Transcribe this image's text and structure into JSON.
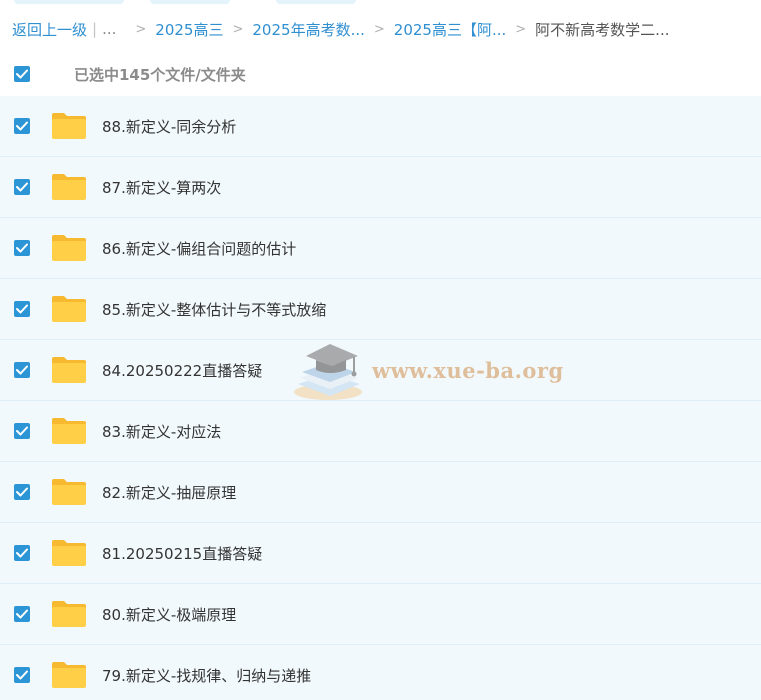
{
  "breadcrumb": {
    "back_label": "返回上一级",
    "ellipsis": "...",
    "items": [
      "2025高三",
      "2025年高考数...",
      "2025高三【阿...",
      "阿不新高考数学二..."
    ]
  },
  "selection": {
    "summary": "已选中145个文件/文件夹",
    "all_checked": true
  },
  "files": [
    {
      "name": "88.新定义-同余分析",
      "type": "folder",
      "checked": true
    },
    {
      "name": "87.新定义-算两次",
      "type": "folder",
      "checked": true
    },
    {
      "name": "86.新定义-偏组合问题的估计",
      "type": "folder",
      "checked": true
    },
    {
      "name": "85.新定义-整体估计与不等式放缩",
      "type": "folder",
      "checked": true
    },
    {
      "name": "84.20250222直播答疑",
      "type": "folder",
      "checked": true
    },
    {
      "name": "83.新定义-对应法",
      "type": "folder",
      "checked": true
    },
    {
      "name": "82.新定义-抽屉原理",
      "type": "folder",
      "checked": true
    },
    {
      "name": "81.20250215直播答疑",
      "type": "folder",
      "checked": true
    },
    {
      "name": "80.新定义-极端原理",
      "type": "folder",
      "checked": true
    },
    {
      "name": "79.新定义-找规律、归纳与递推",
      "type": "folder",
      "checked": true
    }
  ],
  "watermark": {
    "text": "www.xue-ba.org",
    "icon": "graduation-cap-books-logo"
  },
  "colors": {
    "accent": "#2c95d6",
    "link": "#2f8fd1",
    "row_bg": "#f2f9fd",
    "folder": "#ffcf48"
  },
  "icons": {
    "checkbox": "checkmark-icon",
    "folder": "folder-icon",
    "separator": "chevron-right-icon"
  }
}
